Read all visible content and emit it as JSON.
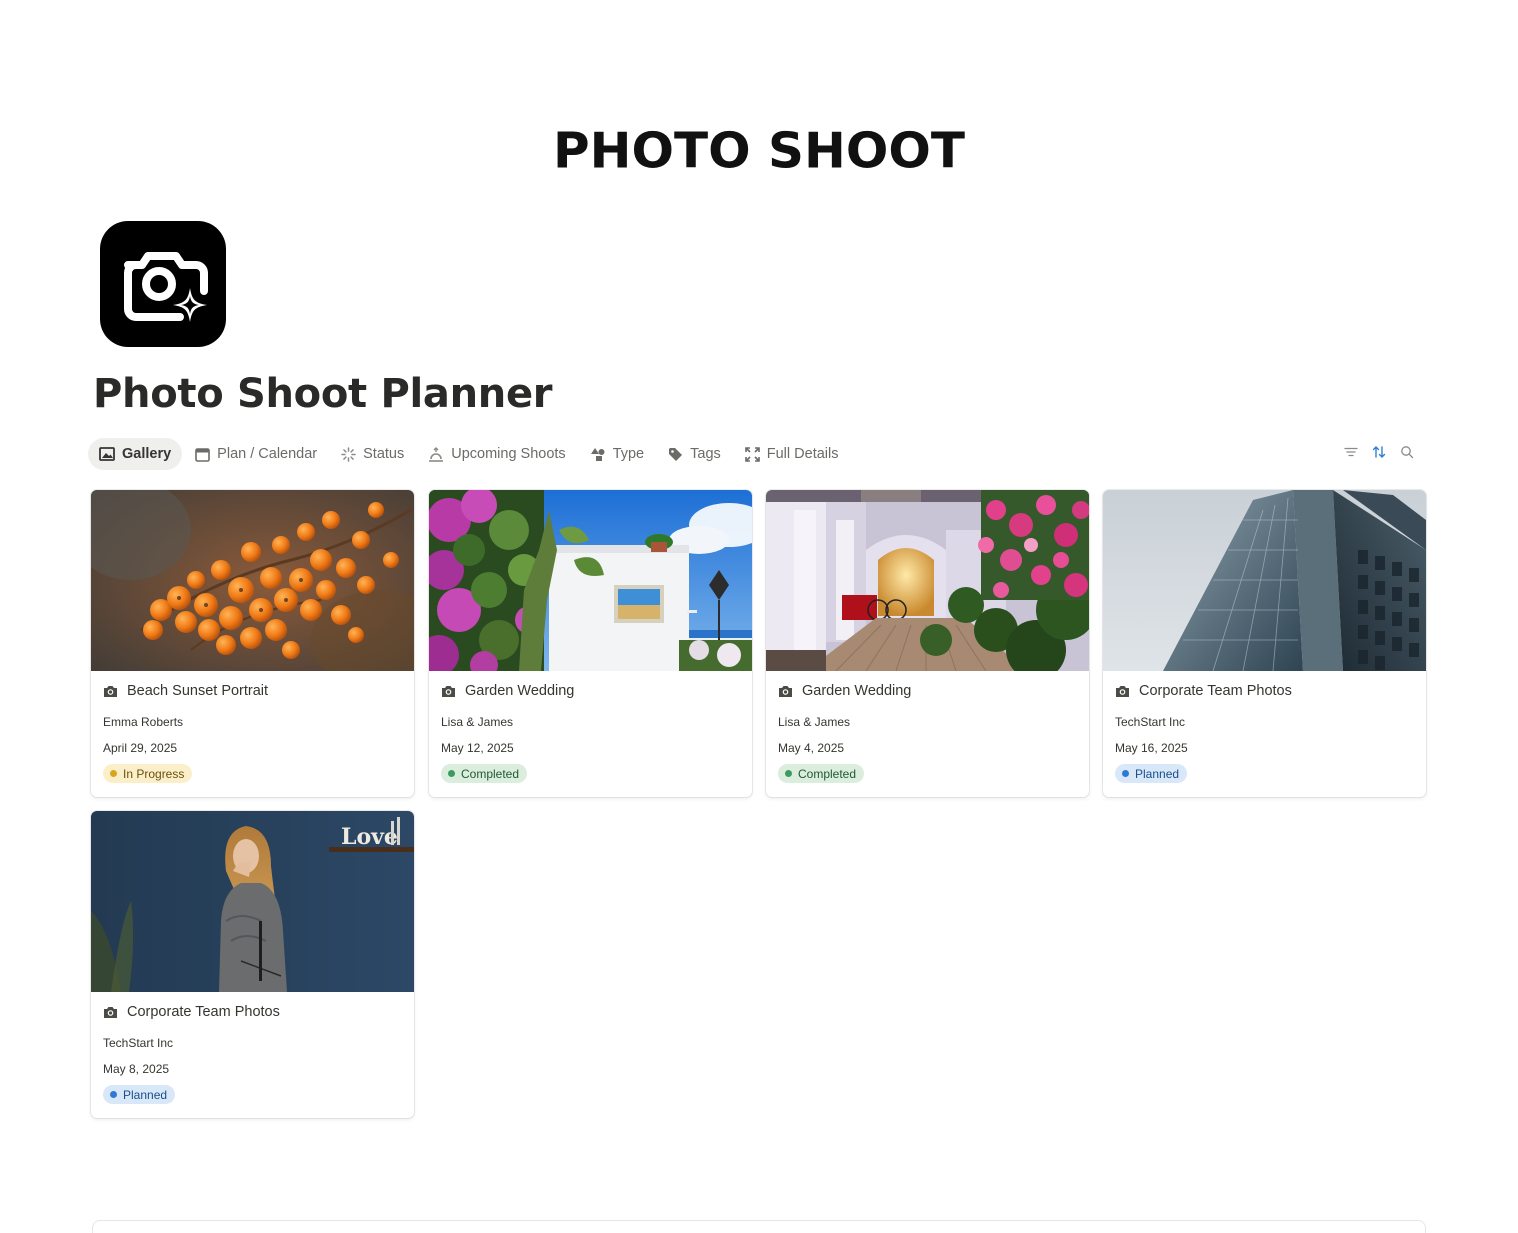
{
  "cover": {
    "heading": "PHOTO SHOOT"
  },
  "page": {
    "title": "Photo Shoot Planner",
    "icon": "camera-sparkle-icon"
  },
  "tabs": [
    {
      "label": "Gallery",
      "icon": "gallery-icon",
      "active": true
    },
    {
      "label": "Plan / Calendar",
      "icon": "calendar-icon",
      "active": false
    },
    {
      "label": "Status",
      "icon": "loading-icon",
      "active": false
    },
    {
      "label": "Upcoming Shoots",
      "icon": "upcoming-icon",
      "active": false
    },
    {
      "label": "Type",
      "icon": "shapes-icon",
      "active": false
    },
    {
      "label": "Tags",
      "icon": "tag-icon",
      "active": false
    },
    {
      "label": "Full Details",
      "icon": "expand-icon",
      "active": false
    }
  ],
  "tools": [
    "filter-icon",
    "sort-icon",
    "search-icon"
  ],
  "status_colors": {
    "In Progress": {
      "bg": "#fbefc9",
      "dot": "#d9a520",
      "text": "#6b4f0e"
    },
    "Completed": {
      "bg": "#dbeddd",
      "dot": "#3d9a61",
      "text": "#1f5a34"
    },
    "Planned": {
      "bg": "#d8e8f8",
      "dot": "#2c7ad6",
      "text": "#1a4d8a"
    }
  },
  "cards": [
    {
      "title": "Beach Sunset Portrait",
      "client": "Emma Roberts",
      "date": "April 29, 2025",
      "status": "In Progress",
      "cover": "orange-berries-photo"
    },
    {
      "title": "Garden Wedding",
      "client": "Lisa & James",
      "date": "May 12, 2025",
      "status": "Completed",
      "cover": "garden-house-photo"
    },
    {
      "title": "Garden Wedding",
      "client": "Lisa & James",
      "date": "May 4, 2025",
      "status": "Completed",
      "cover": "courtyard-flowers-photo"
    },
    {
      "title": "Corporate Team Photos",
      "client": "TechStart Inc",
      "date": "May 16, 2025",
      "status": "Planned",
      "cover": "glass-tower-photo"
    },
    {
      "title": "Corporate Team Photos",
      "client": "TechStart Inc",
      "date": "May 8, 2025",
      "status": "Planned",
      "cover": "portrait-woman-photo",
      "sign_text": "Love"
    }
  ]
}
